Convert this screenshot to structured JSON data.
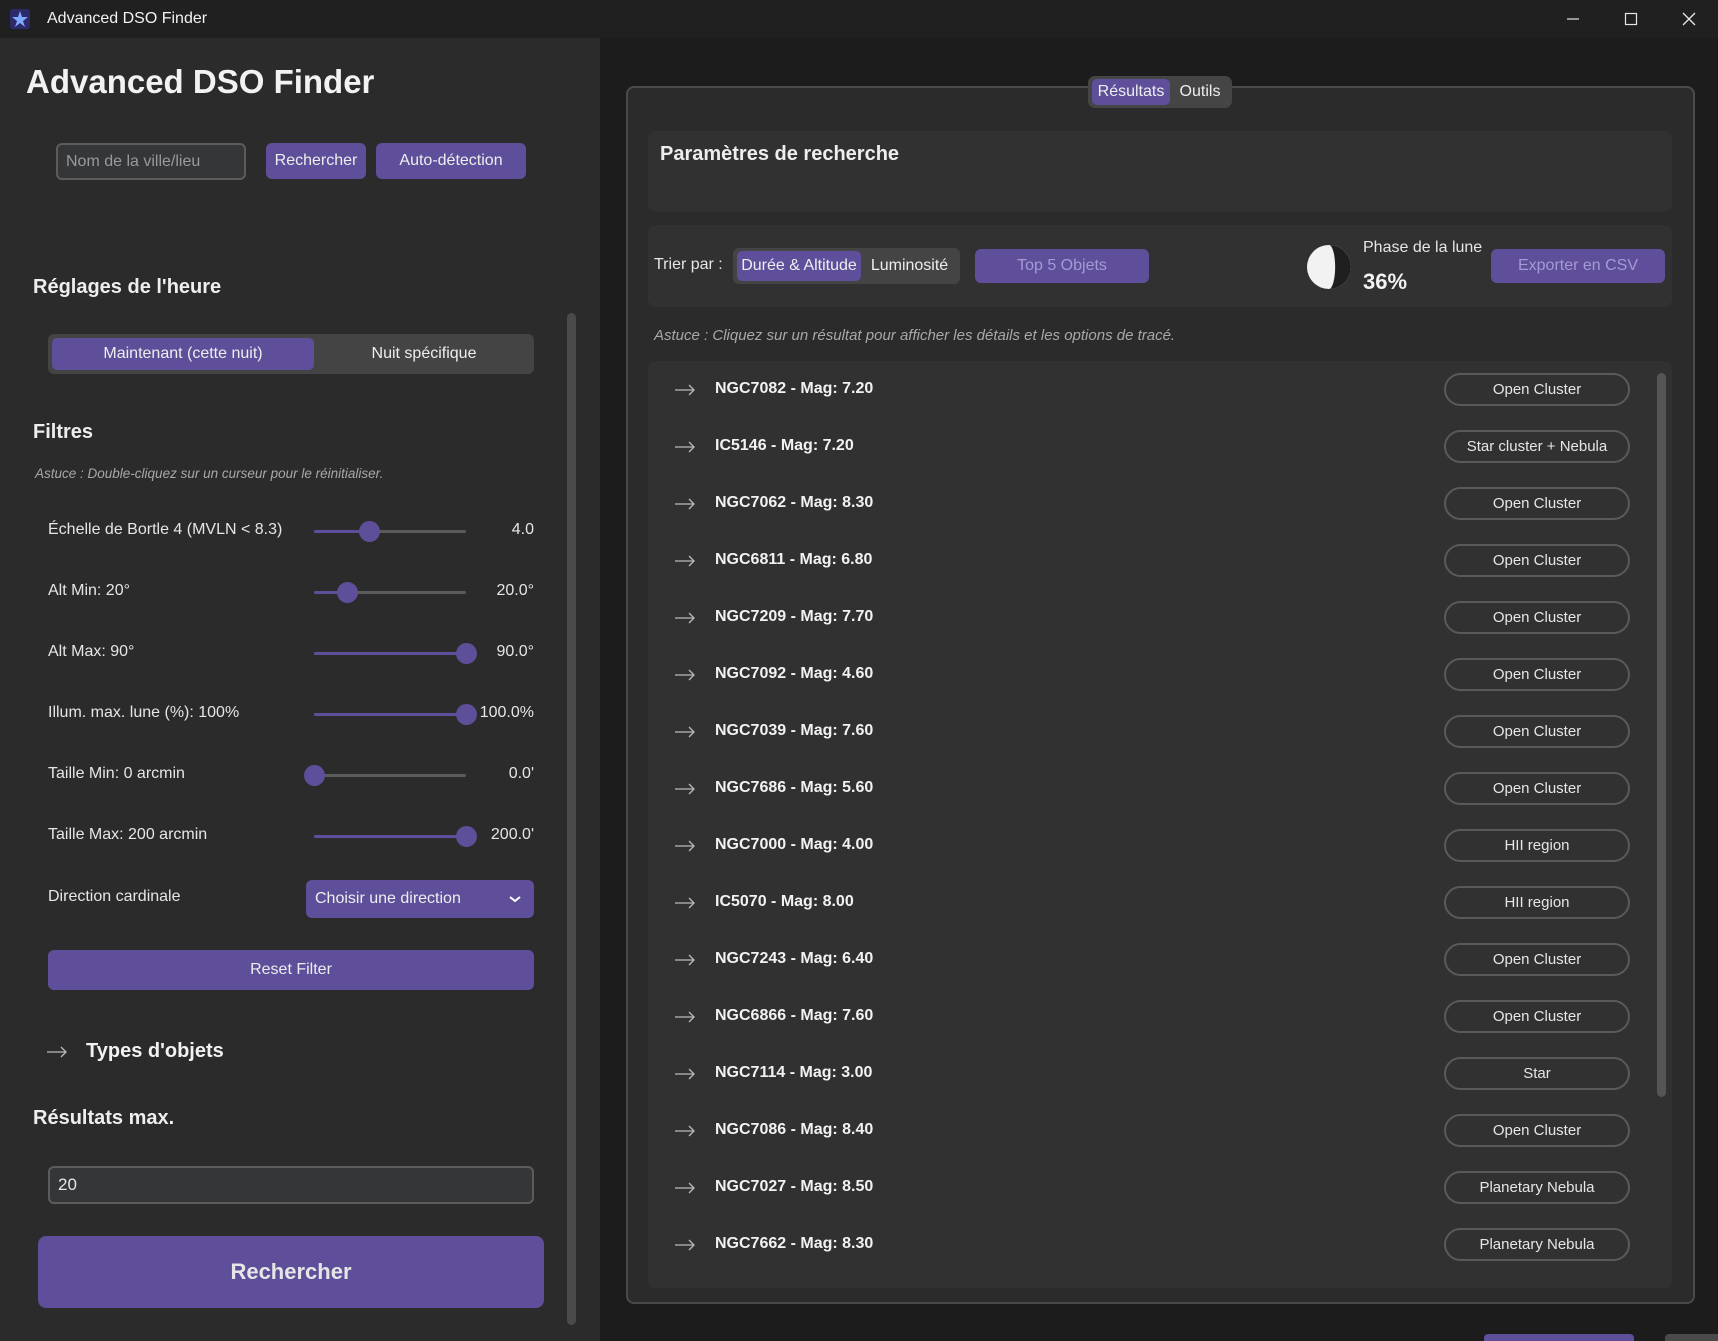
{
  "window": {
    "title": "Advanced DSO Finder"
  },
  "left": {
    "heading": "Advanced DSO Finder",
    "city_placeholder": "Nom de la ville/lieu",
    "search_label": "Rechercher",
    "auto_label": "Auto-détection",
    "time_title": "Réglages de l'heure",
    "time_options": [
      "Maintenant (cette nuit)",
      "Nuit spécifique"
    ],
    "time_selected": 0,
    "filters_title": "Filtres",
    "filters_hint": "Astuce : Double-cliquez sur un curseur pour le réinitialiser.",
    "filters": [
      {
        "label": "Échelle de Bortle 4 (MVLN < 8.3)",
        "value_text": "4.0",
        "fraction": 0.36
      },
      {
        "label": "Alt Min: 20°",
        "value_text": "20.0°",
        "fraction": 0.22
      },
      {
        "label": "Alt Max: 90°",
        "value_text": "90.0°",
        "fraction": 1.0
      },
      {
        "label": "Illum. max. lune (%): 100%",
        "value_text": "100.0%",
        "fraction": 1.0
      },
      {
        "label": "Taille Min: 0 arcmin",
        "value_text": "0.0'",
        "fraction": 0.0
      },
      {
        "label": "Taille Max: 200 arcmin",
        "value_text": "200.0'",
        "fraction": 1.0
      }
    ],
    "direction_label": "Direction cardinale",
    "direction_value": "Choisir une direction",
    "reset_label": "Reset Filter",
    "types_label": "Types d'objets",
    "max_results_title": "Résultats max.",
    "max_results_value": "20",
    "big_search_label": "Rechercher"
  },
  "right": {
    "tabs": [
      "Résultats",
      "Outils"
    ],
    "tab_selected": 0,
    "params_title": "Paramètres de recherche",
    "sort_label": "Trier par :",
    "sort_options": [
      "Durée & Altitude",
      "Luminosité"
    ],
    "sort_selected": 0,
    "top5_label": "Top 5 Objets",
    "moon_label": "Phase de la lune",
    "moon_pct": "36%",
    "moon_illumination": 0.36,
    "export_label": "Exporter en CSV",
    "hint": "Astuce : Cliquez sur un résultat pour afficher les détails et les options de tracé.",
    "results": [
      {
        "name": "NGC7082 - Mag: 7.20",
        "type": "Open Cluster"
      },
      {
        "name": "IC5146 - Mag: 7.20",
        "type": "Star cluster + Nebula"
      },
      {
        "name": "NGC7062 - Mag: 8.30",
        "type": "Open Cluster"
      },
      {
        "name": "NGC6811 - Mag: 6.80",
        "type": "Open Cluster"
      },
      {
        "name": "NGC7209 - Mag: 7.70",
        "type": "Open Cluster"
      },
      {
        "name": "NGC7092 - Mag: 4.60",
        "type": "Open Cluster"
      },
      {
        "name": "NGC7039 - Mag: 7.60",
        "type": "Open Cluster"
      },
      {
        "name": "NGC7686 - Mag: 5.60",
        "type": "Open Cluster"
      },
      {
        "name": "NGC7000 - Mag: 4.00",
        "type": "HII region"
      },
      {
        "name": "IC5070 - Mag: 8.00",
        "type": "HII region"
      },
      {
        "name": "NGC7243 - Mag: 6.40",
        "type": "Open Cluster"
      },
      {
        "name": "NGC6866 - Mag: 7.60",
        "type": "Open Cluster"
      },
      {
        "name": "NGC7114 - Mag: 3.00",
        "type": "Star"
      },
      {
        "name": "NGC7086 - Mag: 8.40",
        "type": "Open Cluster"
      },
      {
        "name": "NGC7027 - Mag: 8.50",
        "type": "Planetary Nebula"
      },
      {
        "name": "NGC7662 - Mag: 8.30",
        "type": "Planetary Nebula"
      }
    ]
  },
  "colors": {
    "accent": "#5f4f9a",
    "panel": "#2b2b2b",
    "inset": "#313131"
  }
}
